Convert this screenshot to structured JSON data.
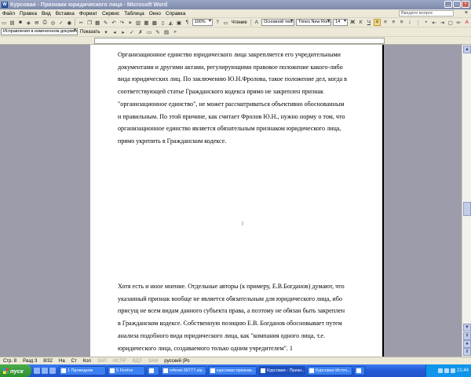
{
  "window": {
    "title": "Курсовая - Признаки юридического лица - Microsoft Word"
  },
  "menu": {
    "items": [
      "Файл",
      "Правка",
      "Вид",
      "Вставка",
      "Формат",
      "Сервис",
      "Таблица",
      "Окно",
      "Справка"
    ],
    "help_placeholder": "Введите вопрос"
  },
  "toolbar": {
    "zoom": "100%",
    "reading": "Чтение",
    "style": "Основной текст",
    "font": "Times New Roman",
    "size": "14",
    "track_mode": "Исправления в измененном документе",
    "show": "Показать"
  },
  "document": {
    "page1_lines": [
      "Организационное единство юридического лица закрепляется его учредительными",
      "документами и другими актами, регулирующими правовое положение какого-либо",
      "вида юридических лиц. По заключению Ю.Н.Фролова, такое положение дел, когда в",
      "соответствующей статье Гражданского кодекса прямо не закреплен признак",
      "\"организационное единство\", не может рассматриваться объективно обоснованным",
      "и правильным. По этой причине, как считает Фролов Ю.Н., нужно норму о том, что",
      "организационное единство является обязательным признаком юридического лица,",
      "прямо укрепить в Гражданском кодексе."
    ],
    "page2_lines": [
      "Хотя есть и иное мнение. Отдельные авторы (к примеру, Е.В.Богданов) думают, что",
      "указанный признак вообще не является обязательным для юридического лица, ибо",
      "присущ не всем видам данного субъекта права, а поэтому не обязан быть закреплен",
      "в Гражданском кодексе. Собственную позицию Е.В. Богданов обосновывает путем",
      "анализа подобного вида юридического лица, как \"компания одного лица, т.е.",
      "юридического лица, создаваемого только одним учредителем\". 1"
    ]
  },
  "status": {
    "page": "Стр. 8",
    "section": "Разд 3",
    "pages": "8/32",
    "at": "На",
    "line": "Ст",
    "col": "Кол",
    "rec": "ЗАП",
    "trk": "ИСПР",
    "ext": "ВДЛ",
    "ovr": "ЗАМ",
    "lang": "русский (Ро"
  },
  "taskbar": {
    "start": "пуск",
    "tasks": [
      "1 Проводник",
      "5 Firefox",
      "",
      "referat-39777.zip...",
      "курсовая признак...",
      "Курсовая - Призн...",
      "Курсовая Источ...",
      ""
    ],
    "clock": "21:44"
  }
}
